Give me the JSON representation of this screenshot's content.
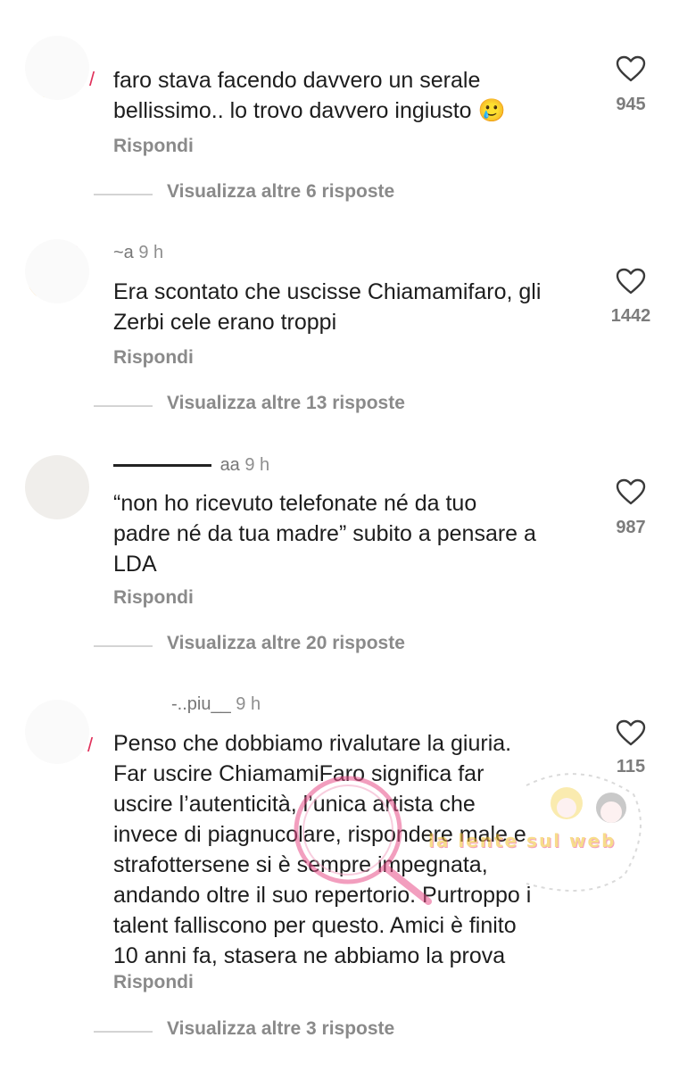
{
  "comments": [
    {
      "username": "",
      "time": "",
      "text": "faro stava facendo davvero un serale\nbellissimo.. lo trovo davvero ingiusto 🥲",
      "reply_label": "Rispondi",
      "likes": "945",
      "more_replies": "Visualizza altre 6 risposte"
    },
    {
      "username": "~a",
      "time": "9 h",
      "text": "Era scontato che uscisse Chiamamifaro, gli\nZerbi cele erano troppi",
      "reply_label": "Rispondi",
      "likes": "1442",
      "more_replies": "Visualizza altre 13 risposte"
    },
    {
      "username": "aa",
      "time": "9 h",
      "text": "“non ho ricevuto telefonate né da tuo\npadre né da tua madre” subito a pensare a\nLDA",
      "reply_label": "Rispondi",
      "likes": "987",
      "more_replies": "Visualizza altre 20 risposte"
    },
    {
      "username": "-..piu__",
      "time": "9 h",
      "text": "Penso che dobbiamo rivalutare la giuria.\nFar uscire ChiamamiFaro significa far\nuscire l’autenticità, l’unica artista che\ninvece di piagnucolare, rispondere male e\nstrafottersene si è sempre impegnata,\nandando oltre il suo repertorio. Purtroppo i\ntalent falliscono per questo. Amici è finito\n10 anni fa, stasera ne abbiamo la prova",
      "reply_label": "Rispondi",
      "likes": "115",
      "more_replies": "Visualizza altre 3 risposte"
    }
  ],
  "watermark": {
    "text": "la lente sul web",
    "colors": {
      "pink": "#e8508a",
      "yellow": "#f2c12e",
      "cyan": "#4fc3d9"
    }
  },
  "icons": {
    "heart": "heart-outline-icon"
  }
}
